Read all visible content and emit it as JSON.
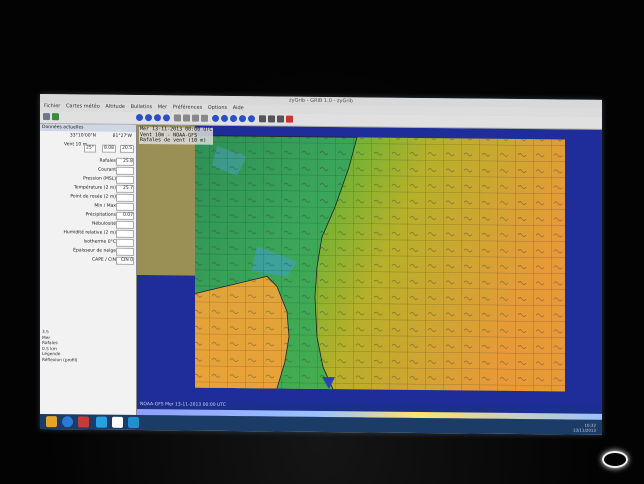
{
  "window": {
    "title": "zyGrib - GRIB 1.0 - zyGrib"
  },
  "menu": [
    "Fichier",
    "Cartes météo",
    "Altitude",
    "Bulletins",
    "Mer",
    "Préférences",
    "Options",
    "Aide"
  ],
  "toolbar": {
    "date_value": "Mer 13-11-2013 00:00 UTC"
  },
  "left_panel": {
    "header": "Données actuelles",
    "position": {
      "lat": "33°10'00\"N",
      "lon": "81°27'W"
    },
    "wind": {
      "label": "Vent 10 m",
      "dir": "25°",
      "speed": "8.08",
      "kmh": "20.5"
    },
    "rows": [
      {
        "label": "Rafales",
        "value": "25.8"
      },
      {
        "label": "Courant",
        "value": ""
      },
      {
        "label": "Pression (MSL)",
        "value": ""
      },
      {
        "label": "Température (2 m)",
        "value": "25.7"
      },
      {
        "label": "Point de rosée (2 m)",
        "value": ""
      },
      {
        "label": "Min / Max",
        "value": ""
      },
      {
        "label": "Précipitations",
        "value": "0.07"
      },
      {
        "label": "Nébulosité",
        "value": ""
      },
      {
        "label": "Humidité relative (2 m)",
        "value": ""
      },
      {
        "label": "Isotherme 0°C",
        "value": ""
      },
      {
        "label": "Épaisseur de neige",
        "value": ""
      },
      {
        "label": "CAPE  /  CIN",
        "value": "CIN 0"
      }
    ],
    "footer": [
      "3.5",
      "Mer",
      "Rafales",
      "0.5 km",
      "Légende",
      "Réflexion (profil)"
    ]
  },
  "map": {
    "header_lines": [
      "Mer 13-11-2013 00:00 UTC",
      "Vent 10m - NOAA-GFS",
      "Rafales de vent (10 m)"
    ],
    "status_text": "NOAA-GFS   Mer 13-11-2013 00:00 UTC"
  },
  "taskbar": {
    "clock": "10:32",
    "date": "13/11/2013"
  },
  "colors": {
    "ocean_deep": "#1e2d9a",
    "warm": "#e8a238",
    "mid": "#3fb24a",
    "land": "#9a8f55"
  }
}
